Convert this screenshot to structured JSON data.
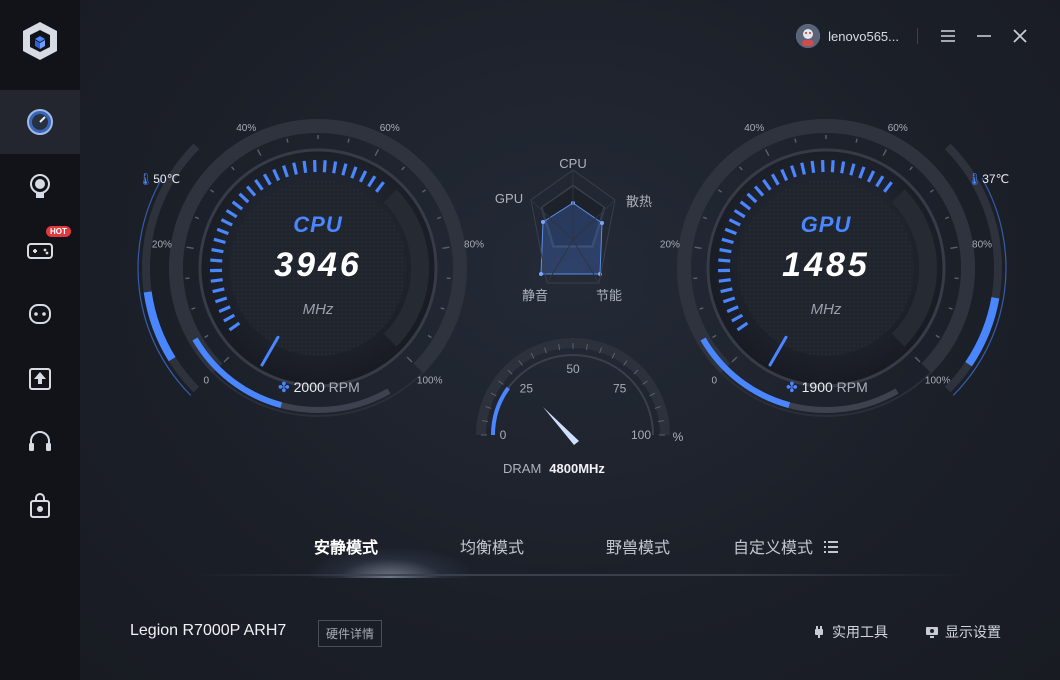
{
  "titlebar": {
    "username": "lenovo565..."
  },
  "cpu_gauge": {
    "label": "CPU",
    "value": "3946",
    "unit": "MHz",
    "temperature": "50℃",
    "fan_speed": "2000",
    "fan_unit": "RPM",
    "ticks": [
      "0",
      "20%",
      "40%",
      "60%",
      "80%",
      "100%"
    ]
  },
  "gpu_gauge": {
    "label": "GPU",
    "value": "1485",
    "unit": "MHz",
    "temperature": "37℃",
    "fan_speed": "1900",
    "fan_unit": "RPM",
    "ticks": [
      "0",
      "20%",
      "40%",
      "60%",
      "80%",
      "100%"
    ]
  },
  "radar": {
    "labels": {
      "top": "CPU",
      "left": "GPU",
      "right": "散热",
      "bottom_left": "静音",
      "bottom_right": "节能"
    }
  },
  "dram_gauge": {
    "label": "DRAM",
    "value": "4800MHz",
    "unit": "%",
    "ticks": [
      "0",
      "25",
      "50",
      "75",
      "100"
    ],
    "level_percent": 20
  },
  "modes": {
    "tabs": [
      "安静模式",
      "均衡模式",
      "野兽模式",
      "自定义模式"
    ],
    "active": "安静模式"
  },
  "footer": {
    "model": "Legion R7000P ARH7",
    "hardware_details": "硬件详情",
    "tools": "实用工具",
    "display_settings": "显示设置"
  },
  "colors": {
    "accent": "#4a86ff",
    "background": "#1b1e26",
    "sidebar": "#111318"
  }
}
